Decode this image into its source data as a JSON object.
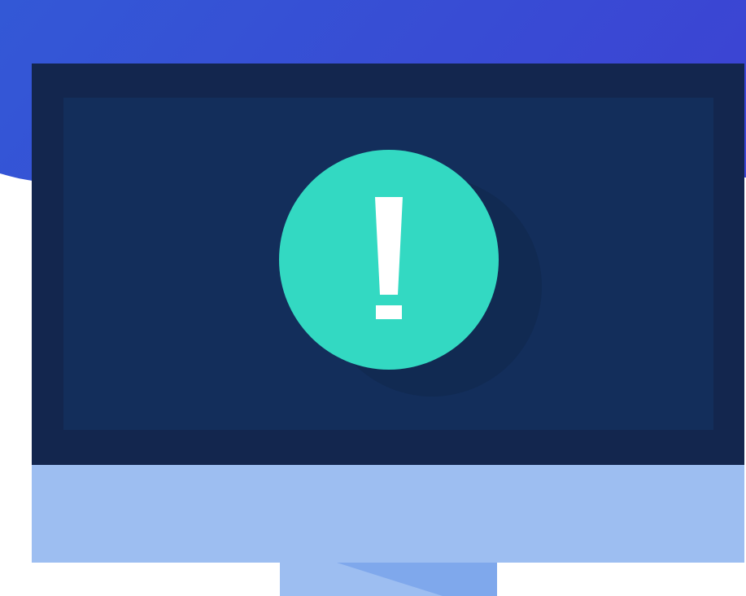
{
  "illustration": {
    "subject": "monitor-with-alert",
    "icon": "exclamation-icon"
  },
  "colors": {
    "backdrop_start": "#3358d6",
    "backdrop_end": "#3b45d3",
    "bezel": "#13264e",
    "screen": "#132e5b",
    "alert": "#33d9c2",
    "alert_shadow": "#112a52",
    "glyph": "#ffffff",
    "chin": "#9dbef1",
    "stand_shade": "#7fa8ec"
  }
}
